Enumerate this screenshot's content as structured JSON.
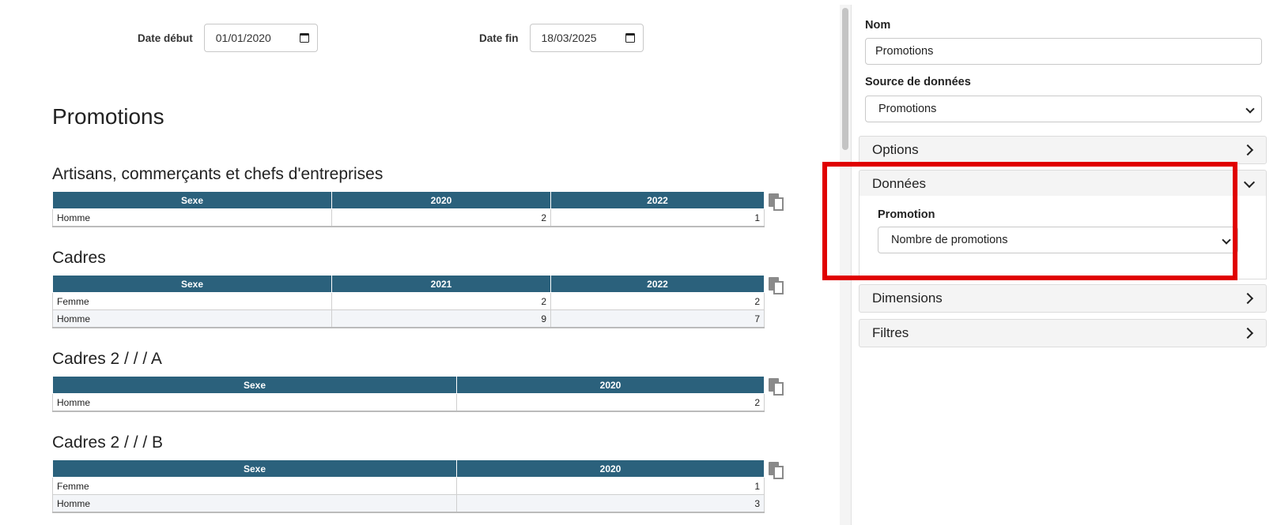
{
  "filters": {
    "start_label": "Date début",
    "start_value": "01/01/2020",
    "end_label": "Date fin",
    "end_value": "18/03/2025"
  },
  "report": {
    "title": "Promotions",
    "sections": [
      {
        "title": "Artisans, commerçants et chefs d'entreprises",
        "columns": [
          "Sexe",
          "2020",
          "2022"
        ],
        "rows": [
          [
            "Homme",
            "2",
            "1"
          ]
        ]
      },
      {
        "title": "Cadres",
        "columns": [
          "Sexe",
          "2021",
          "2022"
        ],
        "rows": [
          [
            "Femme",
            "2",
            "2"
          ],
          [
            "Homme",
            "9",
            "7"
          ]
        ]
      },
      {
        "title": "Cadres 2 / / / A",
        "columns": [
          "Sexe",
          "2020"
        ],
        "rows": [
          [
            "Homme",
            "2"
          ]
        ]
      },
      {
        "title": "Cadres 2 / / / B",
        "columns": [
          "Sexe",
          "2020"
        ],
        "rows": [
          [
            "Femme",
            "1"
          ],
          [
            "Homme",
            "3"
          ]
        ]
      }
    ]
  },
  "panel": {
    "name_label": "Nom",
    "name_value": "Promotions",
    "source_label": "Source de données",
    "source_value": "Promotions",
    "accordions": {
      "options": "Options",
      "donnees": "Données",
      "dimensions": "Dimensions",
      "filtres": "Filtres"
    },
    "promotion_label": "Promotion",
    "promotion_value": "Nombre de promotions"
  },
  "colors": {
    "table_header": "#2b617c",
    "highlight": "#e00000"
  }
}
